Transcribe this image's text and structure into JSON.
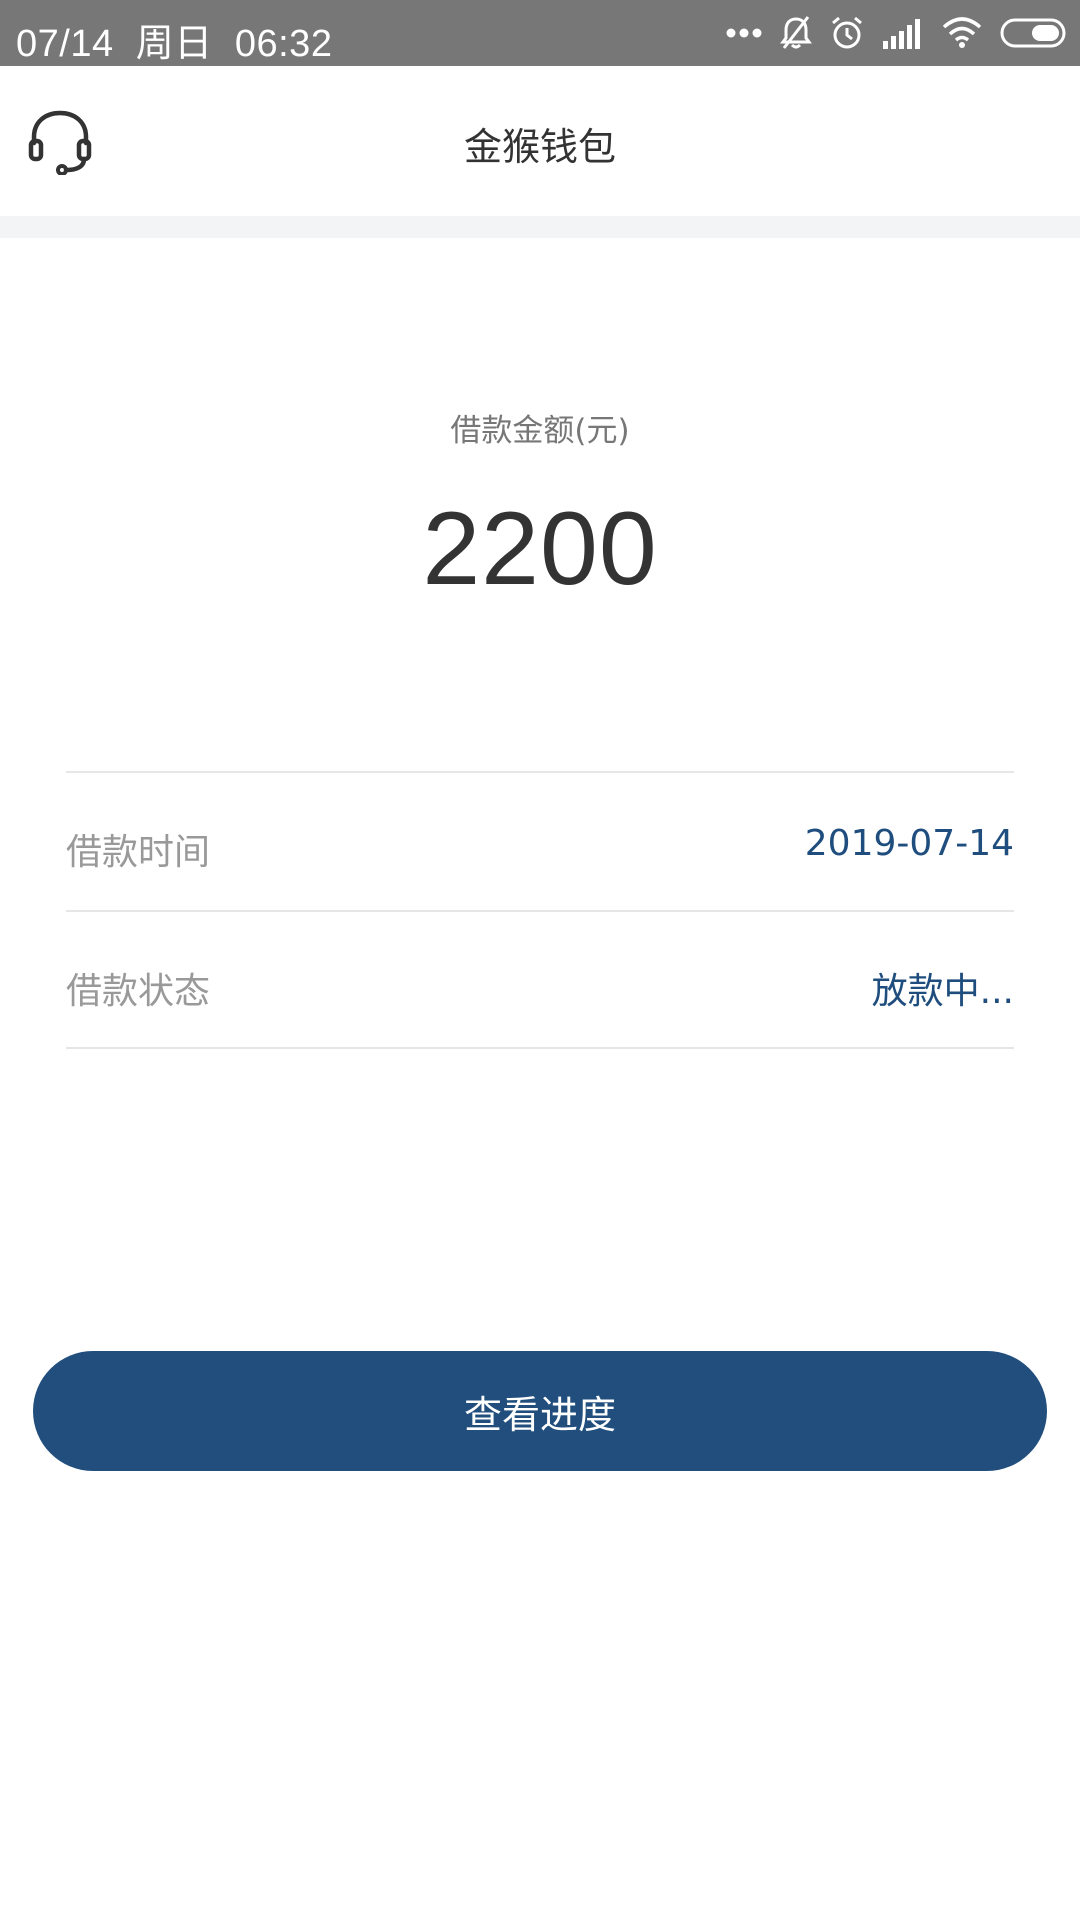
{
  "status_bar": {
    "date": "07/14",
    "weekday": "周日",
    "time": "06:32"
  },
  "header": {
    "title": "金猴钱包",
    "support_icon": "headset-icon"
  },
  "loan": {
    "amount_label": "借款金额(元)",
    "amount_value": "2200"
  },
  "details": [
    {
      "label": "借款时间",
      "value": "2019-07-14"
    },
    {
      "label": "借款状态",
      "value": "放款中..."
    }
  ],
  "actions": {
    "primary_label": "查看进度"
  },
  "colors": {
    "accent": "#214e7d",
    "value_text": "#1f4e7e",
    "status_bar": "#777777"
  }
}
